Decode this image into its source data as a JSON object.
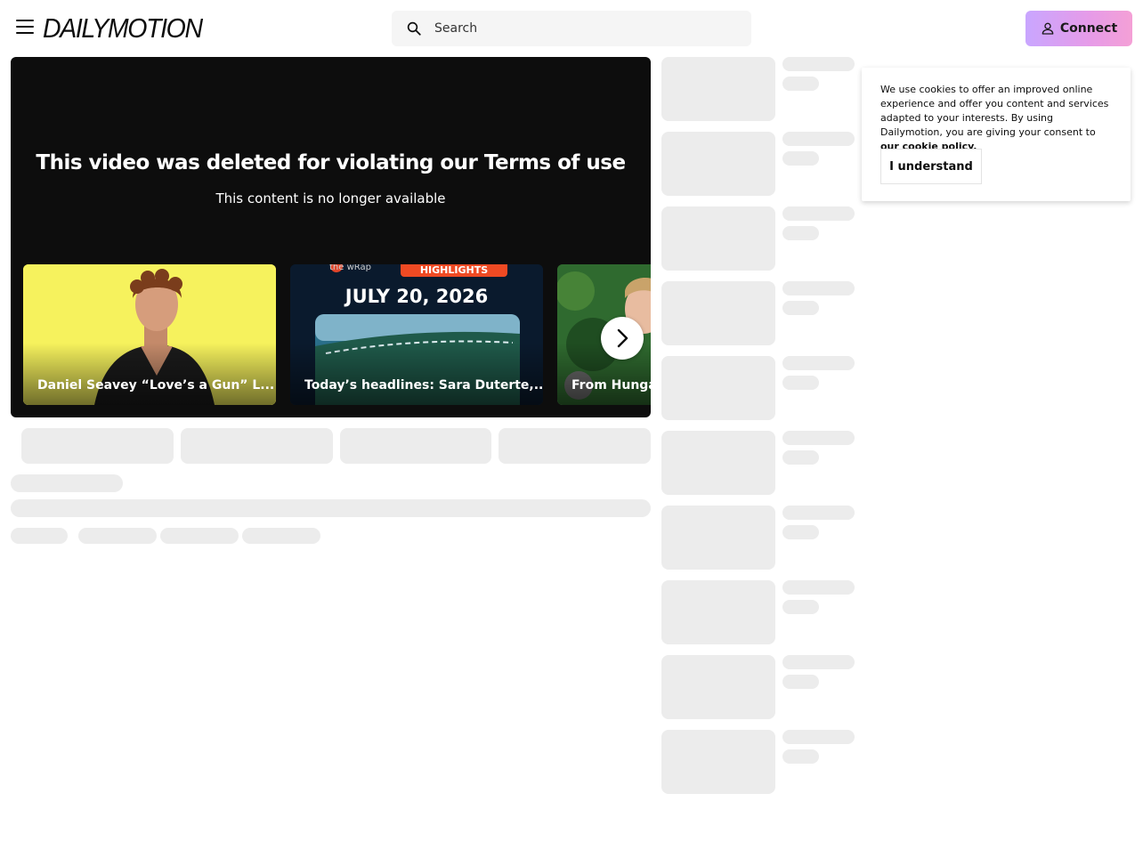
{
  "header": {
    "logo": "DAILYMOTION",
    "search_placeholder": "Search",
    "connect_label": "Connect"
  },
  "player": {
    "title": "This video was deleted for violating our Terms of use",
    "subtitle": "This content is no longer available"
  },
  "carousel": {
    "items": [
      {
        "title": "Daniel Seavey “Love’s a Gun” L..."
      },
      {
        "title": "Today’s headlines: Sara Duterte,...",
        "date": "JULY 20, 2026",
        "brand": "the wRap",
        "badge": "HIGHLIGHTS"
      },
      {
        "title": "From Hunga"
      }
    ]
  },
  "cookie": {
    "text": "We use cookies to offer an improved online experience and offer you content and services adapted to your interests. By using Dailymotion, you are giving your consent to",
    "link": "our cookie policy.",
    "button": "I understand"
  },
  "colors": {
    "accent_gradient_start": "#c9a6ff",
    "accent_gradient_end": "#f4a0d6",
    "player_bg": "#0d0d0d",
    "skeleton": "#ececec"
  }
}
